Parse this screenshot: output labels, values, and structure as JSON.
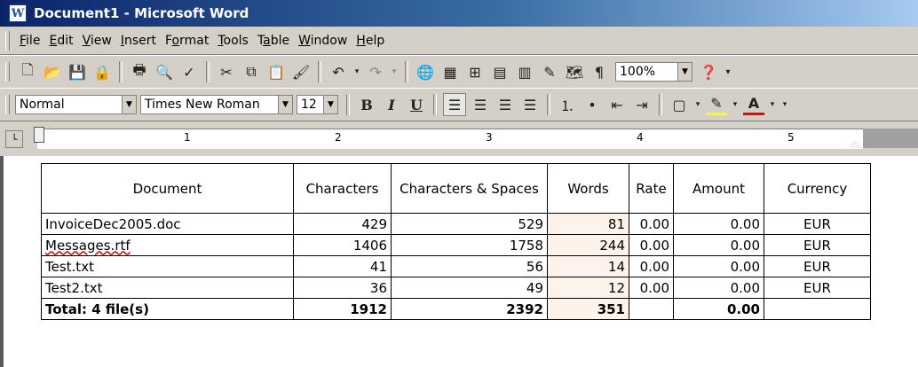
{
  "window": {
    "title": "Document1 - Microsoft Word"
  },
  "menu": [
    {
      "label": "File",
      "accel": "F",
      "rest": "ile"
    },
    {
      "label": "Edit",
      "accel": "E",
      "rest": "dit"
    },
    {
      "label": "View",
      "accel": "V",
      "rest": "iew"
    },
    {
      "label": "Insert",
      "accel": "I",
      "rest": "nsert"
    },
    {
      "label": "Format",
      "pre": "F",
      "accel": "o",
      "rest": "rmat"
    },
    {
      "label": "Tools",
      "accel": "T",
      "rest": "ools"
    },
    {
      "label": "Table",
      "pre": "T",
      "accel": "a",
      "rest": "ble"
    },
    {
      "label": "Window",
      "accel": "W",
      "rest": "indow"
    },
    {
      "label": "Help",
      "accel": "H",
      "rest": "elp"
    }
  ],
  "toolbar": {
    "zoom": "100%",
    "style": "Normal",
    "font": "Times New Roman",
    "size": "12",
    "bold": "B",
    "italic": "I",
    "underline": "U",
    "paragraph_mark": "¶"
  },
  "ruler": {
    "numbers": [
      "1",
      "2",
      "3",
      "4",
      "5"
    ]
  },
  "table": {
    "headers": [
      "Document",
      "Characters",
      "Characters & Spaces",
      "Words",
      "Rate",
      "Amount",
      "Currency"
    ],
    "rows": [
      {
        "document": "InvoiceDec2005.doc",
        "characters": "429",
        "chars_spaces": "529",
        "words": "81",
        "rate": "0.00",
        "amount": "0.00",
        "currency": "EUR"
      },
      {
        "document": "Messages.rtf",
        "characters": "1406",
        "chars_spaces": "1758",
        "words": "244",
        "rate": "0.00",
        "amount": "0.00",
        "currency": "EUR"
      },
      {
        "document": "Test.txt",
        "characters": "41",
        "chars_spaces": "56",
        "words": "14",
        "rate": "0.00",
        "amount": "0.00",
        "currency": "EUR"
      },
      {
        "document": "Test2.txt",
        "characters": "36",
        "chars_spaces": "49",
        "words": "12",
        "rate": "0.00",
        "amount": "0.00",
        "currency": "EUR"
      }
    ],
    "total": {
      "document": "Total: 4 file(s)",
      "characters": "1912",
      "chars_spaces": "2392",
      "words": "351",
      "rate": "",
      "amount": "0.00",
      "currency": ""
    }
  }
}
